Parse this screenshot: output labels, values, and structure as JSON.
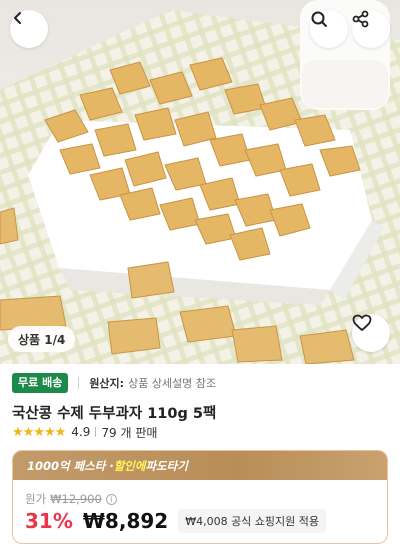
{
  "nav": {
    "back_icon": "chevron-left-icon",
    "search_icon": "search-icon",
    "share_icon": "share-icon"
  },
  "gallery": {
    "counter": "상품 1/4",
    "favorite_icon": "heart-outline-icon"
  },
  "product": {
    "shipping_badge": "무료 배송",
    "origin_label": "원산지:",
    "origin_value": "상품 상세설명 참조",
    "title": "국산콩 수제 두부과자 110g 5팩",
    "rating": "4.9",
    "sales": "79 개 판매"
  },
  "price": {
    "promo_prefix": "1000억 페스타 · ",
    "promo_highlight": "할인에",
    "promo_suffix": " 파도타기",
    "original_label": "원가",
    "original_price": "₩12,900",
    "discount": "31%",
    "sale_price": "₩8,892",
    "support": "₩4,008 공식 쇼핑지원 적용"
  },
  "colors": {
    "discount": "#e8364d",
    "badge": "#1d8a4a",
    "star": "#f3b31b",
    "promo": "#b88d58"
  }
}
